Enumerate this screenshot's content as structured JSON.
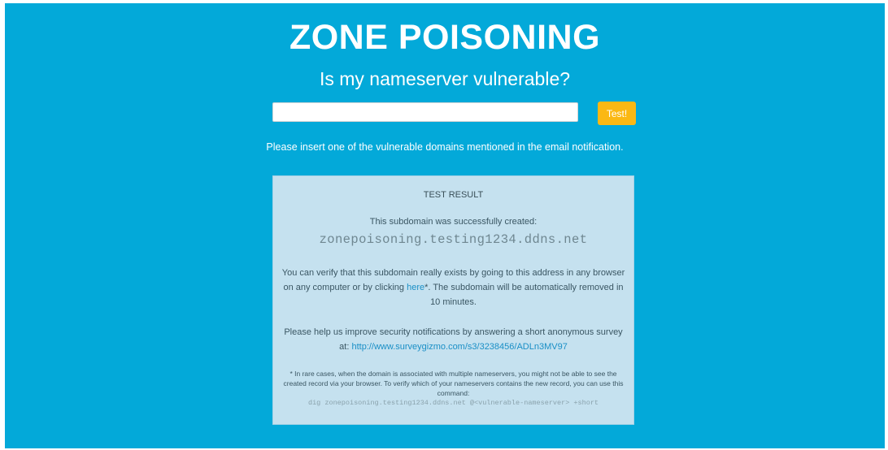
{
  "header": {
    "title": "ZONE POISONING",
    "subtitle": "Is my nameserver vulnerable?"
  },
  "form": {
    "domain_value": "",
    "domain_placeholder": "",
    "test_label": "Test!"
  },
  "hint": "Please insert one of the vulnerable domains mentioned in the email notification.",
  "result": {
    "heading": "TEST RESULT",
    "created_text": "This subdomain was successfully created:",
    "created_domain": "zonepoisoning.testing1234.ddns.net",
    "verify_before": "You can verify that this subdomain really exists by going to this address in any browser on any computer or by clicking ",
    "verify_link": "here",
    "verify_after": "*. The subdomain will be automatically removed in 10 minutes.",
    "survey_before": "Please help us improve security notifications by answering a short anonymous survey at: ",
    "survey_link": "http://www.surveygizmo.com/s3/3238456/ADLn3MV97",
    "footnote": "* In rare cases, when the domain is associated with multiple nameservers, you might not be able to see the created record via your browser. To verify which of your nameservers contains the new record, you can use this command:",
    "command": "dig zonepoisoning.testing1234.ddns.net @<vulnerable-nameserver> +short"
  },
  "colors": {
    "background": "#03a9d9",
    "button": "#fbb813",
    "result_box": "#c5e1ef",
    "link": "#1a8fc6"
  }
}
